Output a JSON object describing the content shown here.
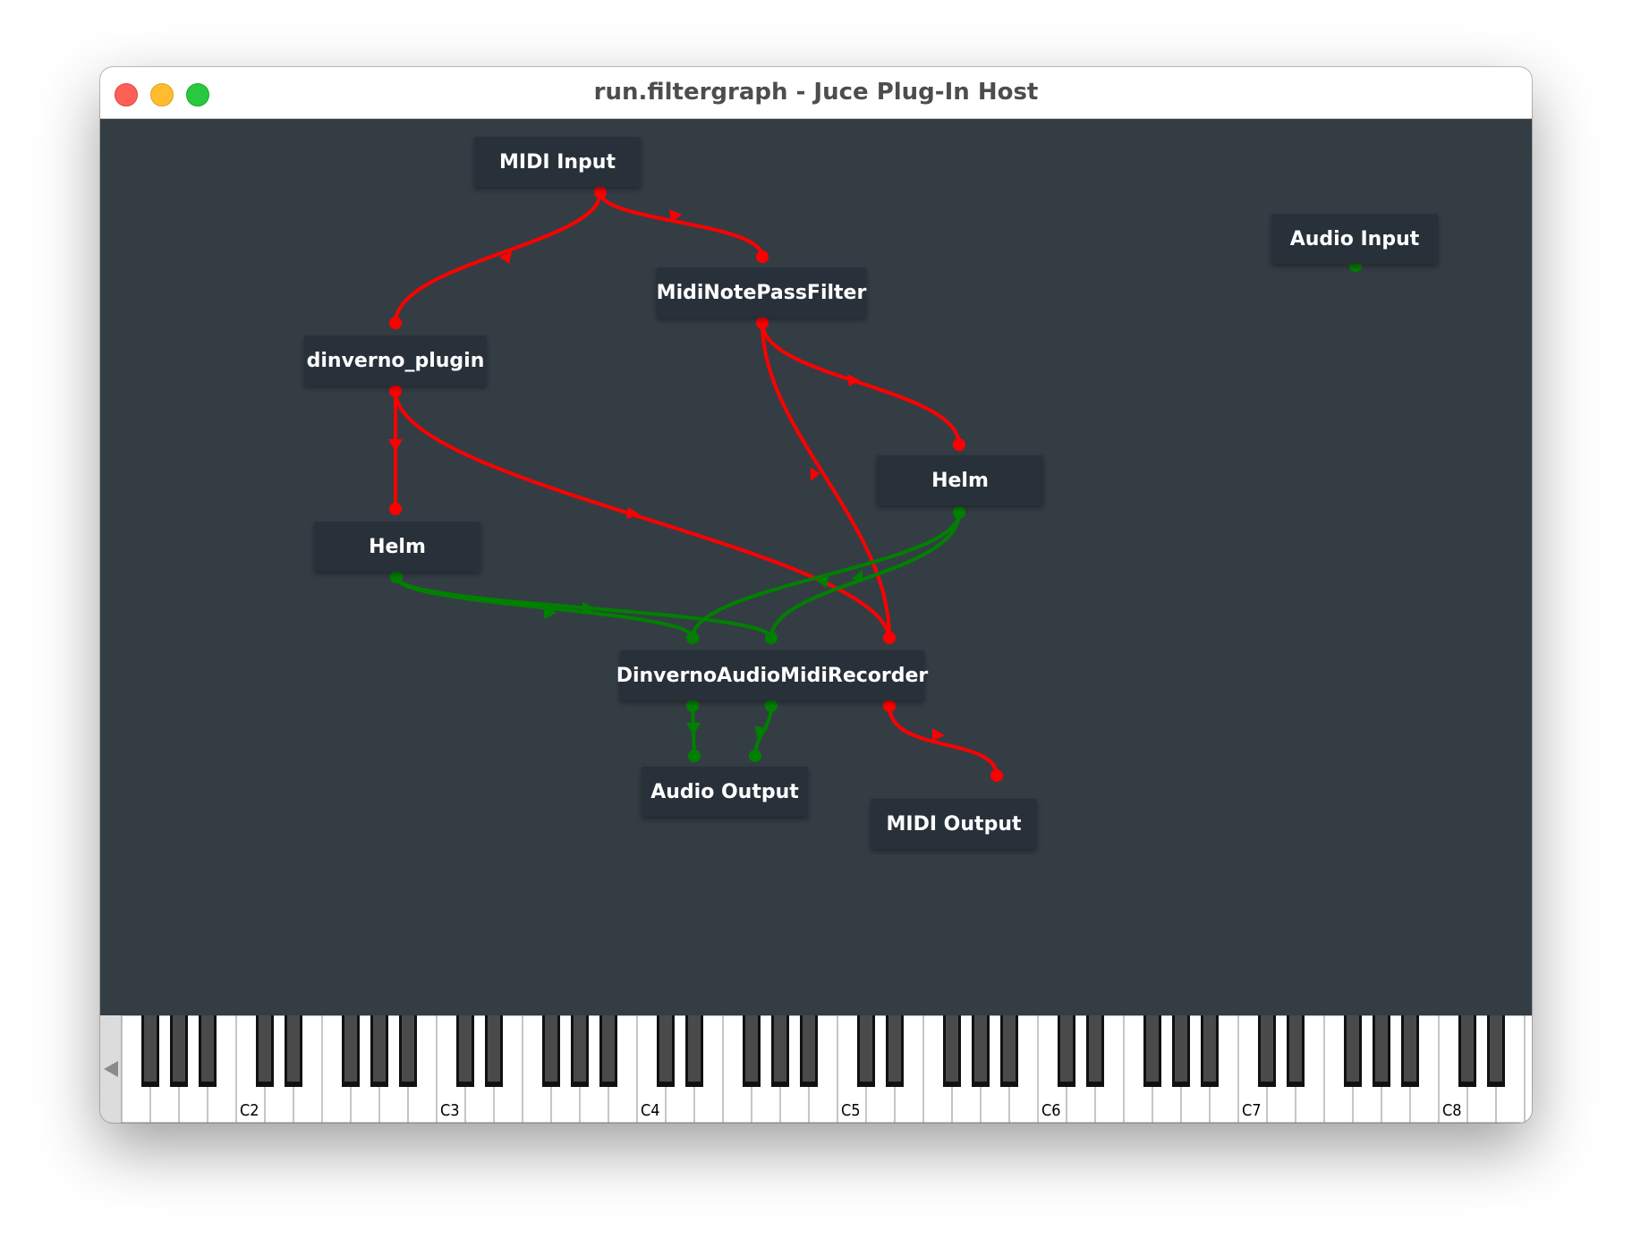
{
  "window": {
    "title": "run.filtergraph - Juce Plug-In Host"
  },
  "colors": {
    "canvas": "#343d44",
    "node": "#28313a",
    "midi_wire": "#ff0000",
    "audio_wire": "#008000"
  },
  "nodes": {
    "midi_input": "MIDI Input",
    "audio_input": "Audio Input",
    "midi_note_pass_filter": "MidiNotePassFilter",
    "dinverno_plugin": "dinverno_plugin",
    "helm_left": "Helm",
    "helm_right": "Helm",
    "recorder": "DinvernoAudioMidiRecorder",
    "audio_output": "Audio Output",
    "midi_output": "MIDI Output"
  },
  "keyboard": {
    "scroll_left_icon": "triangle-left-icon",
    "octave_labels": [
      "C2",
      "C3",
      "C4",
      "C5",
      "C6",
      "C7",
      "C8"
    ]
  }
}
